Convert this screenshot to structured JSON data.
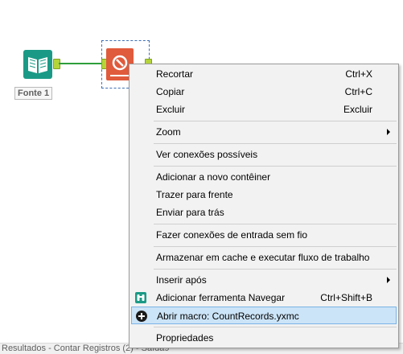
{
  "canvas": {
    "input_tool_label": "Fonte 1"
  },
  "results_bar": {
    "text": "Resultados - Contar Registros (2) - Saída9"
  },
  "context_menu": {
    "items": [
      {
        "label": "Recortar",
        "shortcut": "Ctrl+X"
      },
      {
        "label": "Copiar",
        "shortcut": "Ctrl+C"
      },
      {
        "label": "Excluir",
        "shortcut": "Excluir"
      },
      {
        "label": "Zoom",
        "shortcut": ""
      },
      {
        "label": "Ver conexões possíveis",
        "shortcut": ""
      },
      {
        "label": "Adicionar a novo contêiner",
        "shortcut": ""
      },
      {
        "label": "Trazer para frente",
        "shortcut": ""
      },
      {
        "label": "Enviar para trás",
        "shortcut": ""
      },
      {
        "label": "Fazer conexões de entrada sem fio",
        "shortcut": ""
      },
      {
        "label": "Armazenar em cache e executar fluxo de trabalho",
        "shortcut": ""
      },
      {
        "label": "Inserir após",
        "shortcut": ""
      },
      {
        "label": "Adicionar ferramenta Navegar",
        "shortcut": "Ctrl+Shift+B"
      },
      {
        "label": "Abrir macro: CountRecords.yxmc",
        "shortcut": ""
      },
      {
        "label": "Propriedades",
        "shortcut": ""
      }
    ]
  },
  "colors": {
    "input_tool": "#1a9a86",
    "macro_tool": "#e05a3c",
    "connection": "#2e9e3a",
    "highlight": "#cce4f7"
  }
}
